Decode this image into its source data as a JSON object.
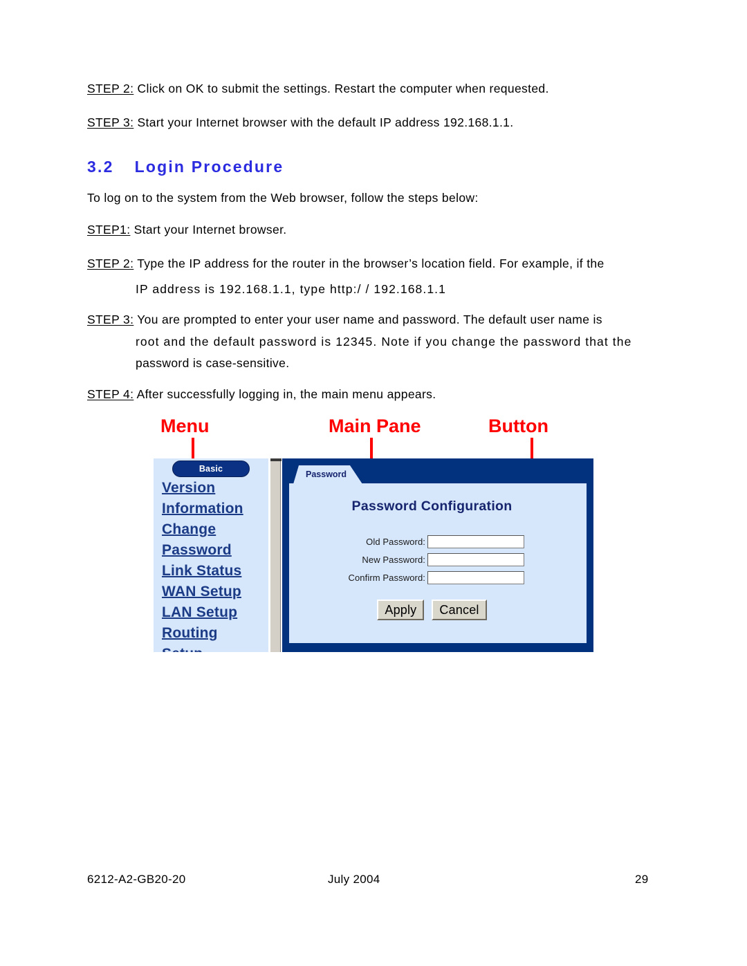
{
  "document": {
    "pre_steps": [
      {
        "tag": "STEP 2:",
        "text": "Click on OK to submit the settings.  Restart the computer when requested."
      },
      {
        "tag": "STEP 3:",
        "text": "Start your Internet browser with the default IP address 192.168.1.1."
      }
    ],
    "section": {
      "number": "3.2",
      "title": "Login Procedure"
    },
    "intro": "To log on to the system from the Web browser, follow the steps below:",
    "steps": [
      {
        "tag": "STEP1:",
        "lines": [
          "Start your Internet browser."
        ]
      },
      {
        "tag": "STEP 2:",
        "lines": [
          "Type the IP address for the router in the browser’s location field.  For example, if the",
          "IP address is 192.168.1.1, type http:/ / 192.168.1.1"
        ]
      },
      {
        "tag": "STEP 3:",
        "lines": [
          "You are prompted to enter your user name and password.  The default user name is",
          "root and the default password is 12345. Note if you change the password that the",
          "password is case-sensitive."
        ]
      },
      {
        "tag": "STEP 4:",
        "lines": [
          "After successfully logging in, the main menu appears."
        ]
      }
    ]
  },
  "annotations": {
    "menu_label": "Menu",
    "main_pane_label": "Main Pane",
    "button_label": "Button",
    "color": "#ff0000"
  },
  "screenshot": {
    "sidebar": {
      "basic_button": "Basic",
      "items": [
        {
          "line1": "Version",
          "line2": "Information"
        },
        {
          "line1": "Change",
          "line2": "Password"
        },
        {
          "line1": "Link Status",
          "line2": ""
        },
        {
          "line1": "WAN Setup",
          "line2": ""
        },
        {
          "line1": "LAN Setup",
          "line2": ""
        },
        {
          "line1": "Routing",
          "line2": "Setup"
        }
      ]
    },
    "main_pane": {
      "tab_label": "Password",
      "title": "Password Configuration",
      "fields": [
        {
          "label": "Old Password:",
          "value": ""
        },
        {
          "label": "New Password:",
          "value": ""
        },
        {
          "label": "Confirm Password:",
          "value": ""
        }
      ],
      "buttons": [
        {
          "label": "Apply"
        },
        {
          "label": "Cancel"
        }
      ]
    },
    "colors": {
      "pane_dark_blue": "#02317e",
      "pane_light_blue": "#d6e6fb",
      "menu_link": "#1b3b86",
      "button_face": "#d9d6cc"
    }
  },
  "footer": {
    "left": "6212-A2-GB20-20",
    "center": "July 2004",
    "right": "29"
  }
}
